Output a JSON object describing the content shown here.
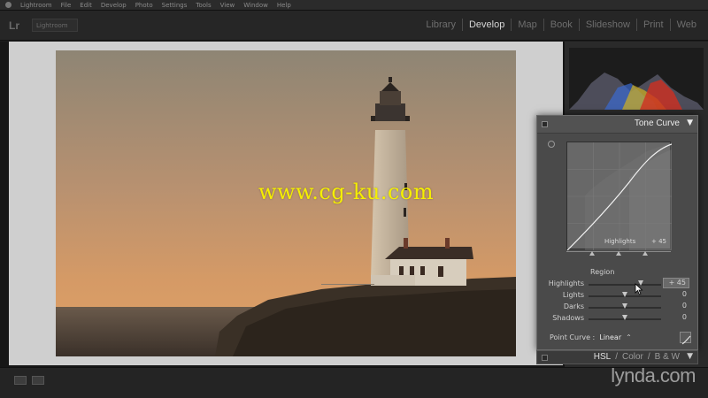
{
  "app": {
    "menubar_items": [
      "Lightroom",
      "File",
      "Edit",
      "Develop",
      "Photo",
      "Settings",
      "Tools",
      "View",
      "Window",
      "Help"
    ],
    "logo": "Lr",
    "identity_plate": "Lightroom"
  },
  "modules": [
    "Library",
    "Develop",
    "Map",
    "Book",
    "Slideshow",
    "Print",
    "Web"
  ],
  "active_module": "Develop",
  "watermark": "www.cg-ku.com",
  "brand_watermark": "lynda.com",
  "tone_curve": {
    "title": "Tone Curve",
    "curve_region_label": "Highlights",
    "curve_region_value": "+ 45",
    "region_title": "Region",
    "sliders": [
      {
        "label": "Highlights",
        "value": "+ 45",
        "level": 0.725
      },
      {
        "label": "Lights",
        "value": "0",
        "level": 0.5
      },
      {
        "label": "Darks",
        "value": "0",
        "level": 0.5
      },
      {
        "label": "Shadows",
        "value": "0",
        "level": 0.5
      }
    ],
    "point_curve_label": "Point Curve :",
    "point_curve_value": "Linear",
    "point_curve_arrow": "⌃"
  },
  "next_panel": {
    "tabs": [
      "HSL",
      "Color",
      "B & W"
    ],
    "separator": "/"
  },
  "icons": {
    "collapse": "▼"
  },
  "colors": {
    "accent_active_module": "#d6d6d6",
    "panel_bg": "#4a4a4a",
    "watermark": "#f5ef00"
  }
}
